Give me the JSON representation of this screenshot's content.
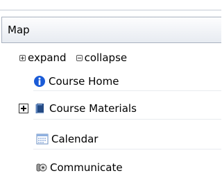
{
  "header": {
    "title": "Map"
  },
  "controls": {
    "expand": "expand",
    "collapse": "collapse"
  },
  "items": [
    {
      "label": "Course Home",
      "icon": "info-icon"
    },
    {
      "label": "Course Materials",
      "icon": "book-icon"
    },
    {
      "label": "Calendar",
      "icon": "calendar-icon"
    },
    {
      "label": "Communicate",
      "icon": "communicate-icon"
    }
  ]
}
